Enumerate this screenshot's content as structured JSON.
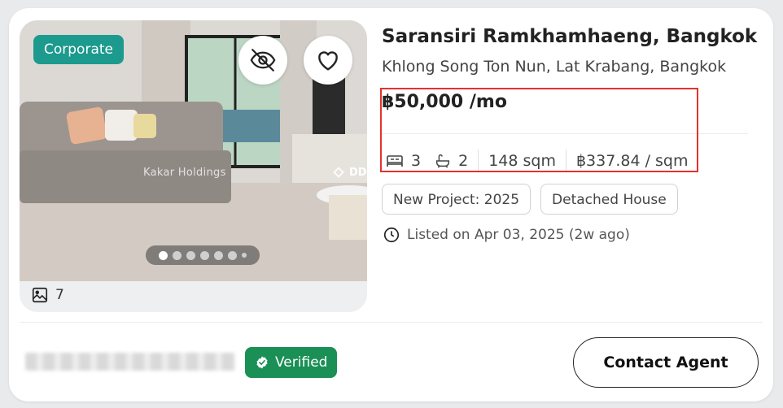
{
  "listing": {
    "badge": "Corporate",
    "watermark": "Kakar Holdings",
    "logo_text": "DD",
    "photo_count": "7",
    "carousel_active_index": 0,
    "title": "Saransiri Ramkhamhaeng, Bangkok",
    "location": "Khlong Song Ton Nun, Lat Krabang, Bangkok",
    "price": "฿50,000 /mo",
    "specs": {
      "beds": "3",
      "baths": "2",
      "area": "148 sqm",
      "price_per_sqm": "฿337.84 / sqm"
    },
    "tags": [
      "New Project: 2025",
      "Detached House"
    ],
    "listed": "Listed on Apr 03, 2025 (2w ago)"
  },
  "agent": {
    "verified_label": "Verified"
  },
  "actions": {
    "contact_label": "Contact Agent"
  },
  "colors": {
    "badge": "#1c9a8e",
    "verified": "#1a8f56",
    "highlight": "#e4322b"
  }
}
